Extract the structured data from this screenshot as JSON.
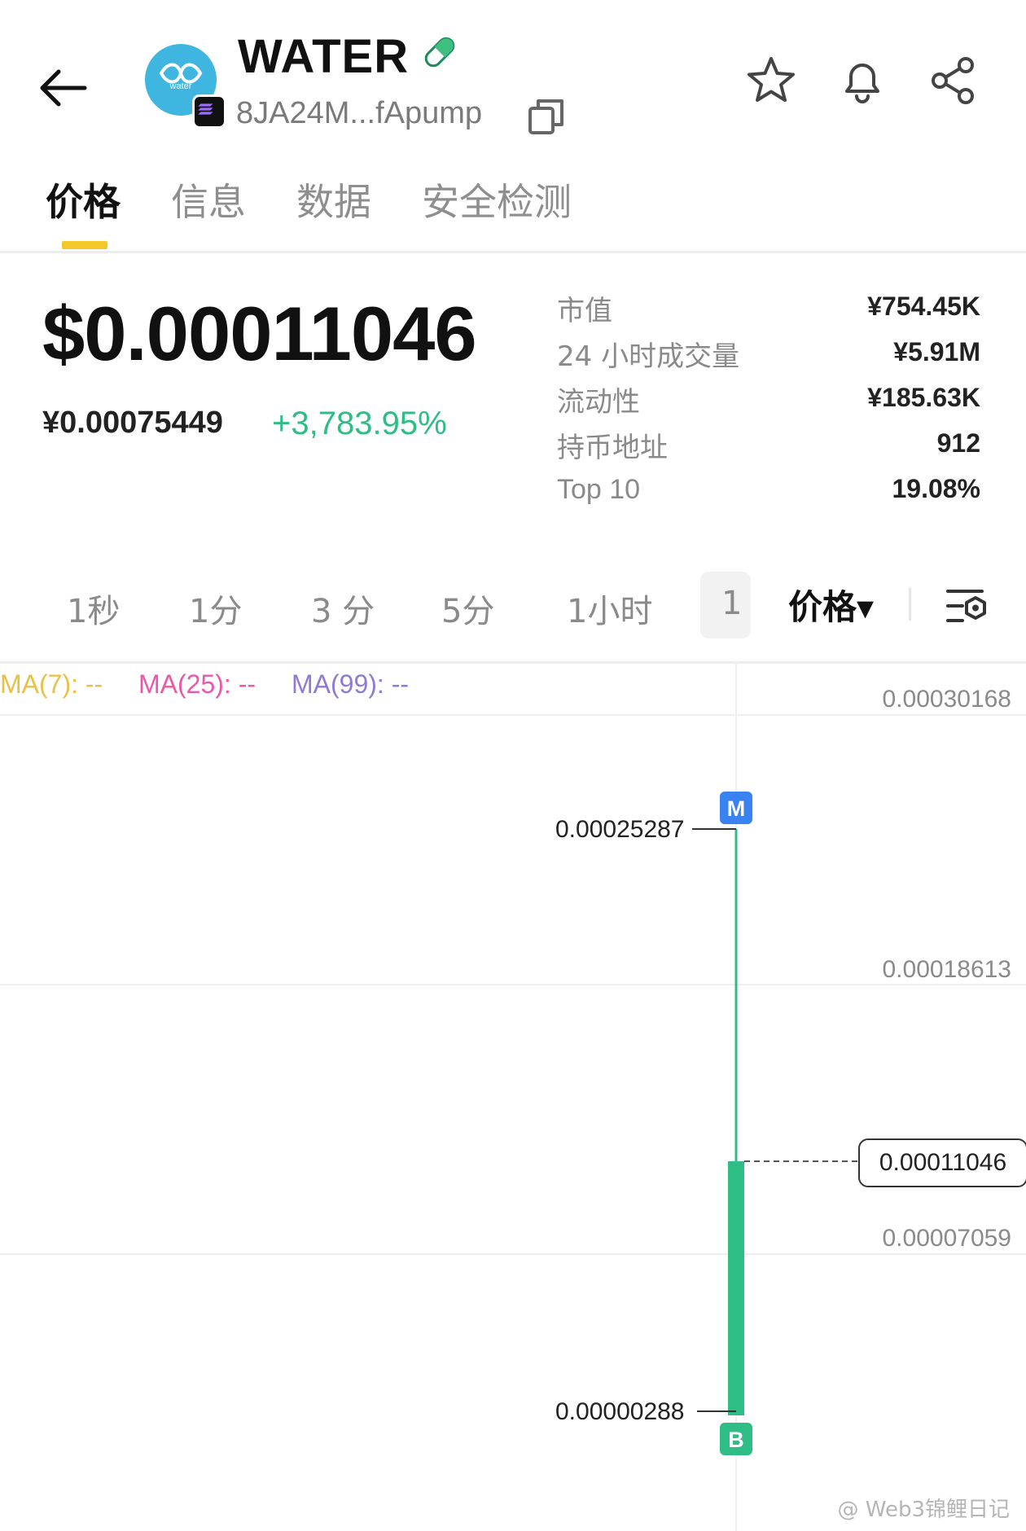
{
  "header": {
    "token_name": "WATER",
    "logo_text": "water",
    "address": "8JA24M...fApump",
    "icons": [
      "back-arrow-icon",
      "star-icon",
      "bell-icon",
      "share-icon",
      "copy-icon",
      "pill-icon"
    ]
  },
  "tabs": [
    {
      "label": "价格",
      "active": true
    },
    {
      "label": "信息",
      "active": false
    },
    {
      "label": "数据",
      "active": false
    },
    {
      "label": "安全检测",
      "active": false
    }
  ],
  "price": {
    "usd": "$0.00011046",
    "cny": "¥0.00075449",
    "change": "+3,783.95%"
  },
  "stats": [
    {
      "label": "市值",
      "value": "¥754.45K"
    },
    {
      "label": "24 小时成交量",
      "value": "¥5.91M"
    },
    {
      "label": "流动性",
      "value": "¥185.63K"
    },
    {
      "label": "持币地址",
      "value": "912"
    },
    {
      "label": "Top 10",
      "value": "19.08%"
    }
  ],
  "intervals": [
    "1秒",
    "1分",
    "3 分",
    "5分",
    "1小时",
    "1"
  ],
  "price_dropdown": "价格▾",
  "ma": {
    "ma7": "MA(7): --",
    "ma25": "MA(25): --",
    "ma99": "MA(99): --"
  },
  "colors": {
    "up": "#2ebd85",
    "ma7": "#e9c14a",
    "ma25": "#e85aa8",
    "ma99": "#8f7ad6",
    "tab_indicator": "#f3c82b",
    "buy_marker": "#2ebd85",
    "migrate_marker": "#3a82f0"
  },
  "chart_data": {
    "type": "candlestick",
    "y_ticks": [
      "0.00030168",
      "0.00018613",
      "0.00007059"
    ],
    "current_price_label": "0.00011046",
    "high_label": "0.00025287",
    "low_label": "0.00000288",
    "candle": {
      "open": 2.88e-06,
      "high": 0.00025287,
      "low": 2.88e-06,
      "close": 0.00011046
    },
    "markers": [
      {
        "label": "M"
      },
      {
        "label": "B"
      }
    ]
  },
  "watermark": "@ Web3锦鲤日记"
}
